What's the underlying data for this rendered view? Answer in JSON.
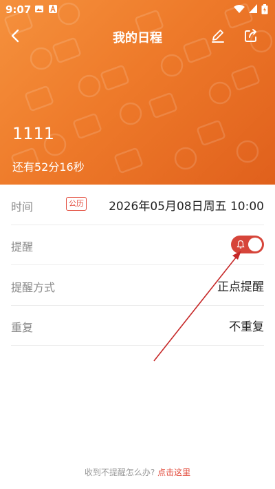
{
  "status_bar": {
    "time": "9:07"
  },
  "nav": {
    "title": "我的日程",
    "back_icon": "chevron-left-icon",
    "edit_icon": "pencil-icon",
    "share_icon": "share-icon"
  },
  "event": {
    "title": "1111",
    "countdown": "还有52分16秒"
  },
  "rows": {
    "time": {
      "label": "时间",
      "calendar_badge": "公历",
      "value": "2026年05月08日周五 10:00"
    },
    "reminder": {
      "label": "提醒",
      "enabled": true
    },
    "reminder_mode": {
      "label": "提醒方式",
      "value": "正点提醒"
    },
    "repeat": {
      "label": "重复",
      "value": "不重复"
    }
  },
  "footer": {
    "question": "收到不提醒怎么办?",
    "link": "点击这里"
  },
  "colors": {
    "header_start": "#f5913d",
    "header_end": "#e0601c",
    "accent": "#e24b3c",
    "toggle_on": "#d6453a"
  }
}
